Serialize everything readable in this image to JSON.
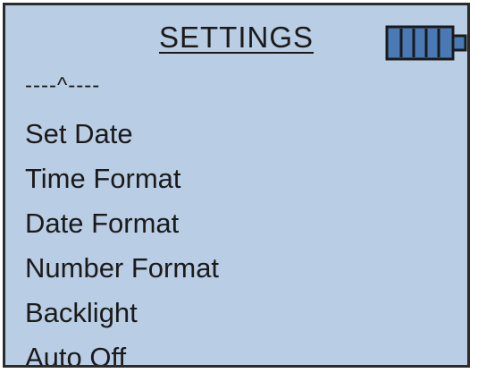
{
  "header": {
    "title": "SETTINGS",
    "battery_icon": "battery-full-icon",
    "battery_level": 1.0
  },
  "scroll_indicator": "----^----",
  "menu": {
    "items": [
      {
        "label": "Set Date"
      },
      {
        "label": "Time Format"
      },
      {
        "label": "Date Format"
      },
      {
        "label": "Number Format"
      },
      {
        "label": "Backlight"
      },
      {
        "label": "Auto Off"
      }
    ]
  },
  "colors": {
    "screen_background": "#b9cde4",
    "border": "#2b2b2b",
    "battery": "#4a7ab5",
    "text": "#1a1a1a"
  }
}
